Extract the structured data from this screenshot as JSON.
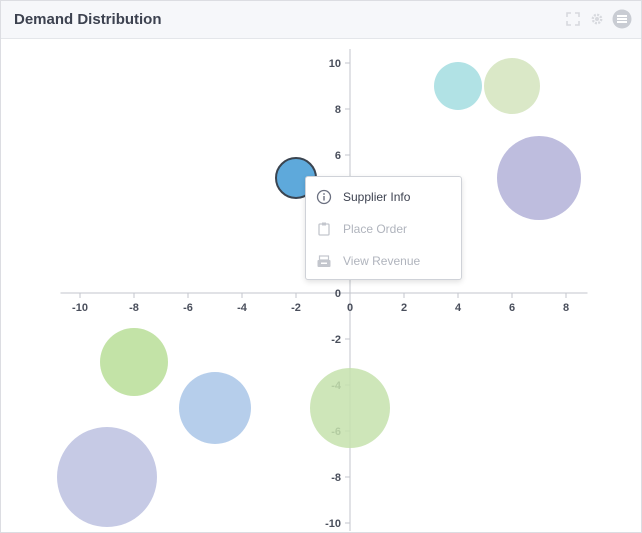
{
  "panel": {
    "title": "Demand Distribution",
    "header_icons": [
      "fullscreen-icon",
      "gear-icon",
      "menu-list-icon"
    ]
  },
  "context_menu": {
    "items": [
      {
        "label": "Supplier Info",
        "icon": "info-circle-icon",
        "enabled": true
      },
      {
        "label": "Place Order",
        "icon": "clipboard-icon",
        "enabled": false
      },
      {
        "label": "View Revenue",
        "icon": "cash-register-icon",
        "enabled": false
      }
    ]
  },
  "chart_data": {
    "type": "scatter",
    "variant": "bubble",
    "title": "",
    "xlabel": "",
    "ylabel": "",
    "xlim": [
      -10.5,
      8.5
    ],
    "ylim": [
      -10,
      10
    ],
    "x_ticks": [
      -10,
      -8,
      -6,
      -4,
      -2,
      0,
      2,
      4,
      6,
      8
    ],
    "y_ticks": [
      -10,
      -8,
      -6,
      -4,
      -2,
      0,
      2,
      4,
      6,
      8,
      10
    ],
    "grid": false,
    "legend": "none",
    "series": [
      {
        "x": -9,
        "y": -8,
        "size": 50,
        "color": "#bcc1e0",
        "selected": false
      },
      {
        "x": -8,
        "y": -3,
        "size": 34,
        "color": "#b9de98",
        "selected": false
      },
      {
        "x": -5,
        "y": -5,
        "size": 36,
        "color": "#a9c6e8",
        "selected": false
      },
      {
        "x": 0,
        "y": -5,
        "size": 40,
        "color": "#c5e2ad",
        "selected": false
      },
      {
        "x": -2,
        "y": 5,
        "size": 20,
        "color": "#5ea9db",
        "selected": true
      },
      {
        "x": 4,
        "y": 9,
        "size": 24,
        "color": "#a3dde0",
        "selected": false
      },
      {
        "x": 6,
        "y": 9,
        "size": 28,
        "color": "#d3e4bd",
        "selected": false
      },
      {
        "x": 7,
        "y": 5,
        "size": 42,
        "color": "#b3b2d8",
        "selected": false
      }
    ]
  }
}
